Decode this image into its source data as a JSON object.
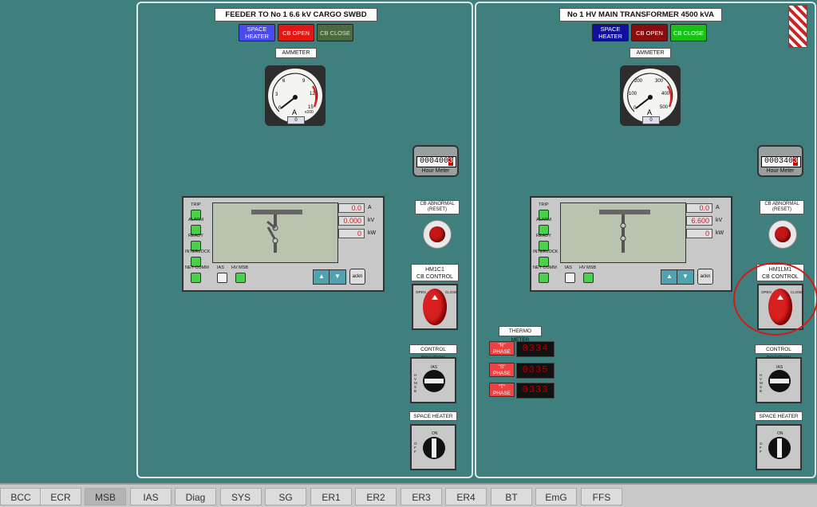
{
  "panel_left": {
    "title": "FEEDER TO No 1 6.6 kV CARGO SWBD",
    "status": {
      "space_heater": "SPACE HEATER",
      "cb_open": "CB OPEN",
      "cb_close": "CB CLOSE"
    },
    "ammeter": {
      "label": "AMMETER",
      "unit": "A",
      "multiplier": "x100",
      "readout": "0",
      "scale": [
        "0",
        "3",
        "6",
        "9",
        "12",
        "15"
      ]
    },
    "hour_meter": {
      "value": "000400",
      "decimal": "3",
      "label": "Hour Meter"
    },
    "relay": {
      "indicators": [
        "TRIP",
        "ALARM",
        "READY",
        "INTERLOCK",
        "NET COMM"
      ],
      "bottom": [
        "IAS",
        "HV MSB"
      ],
      "readings": [
        {
          "value": "0.0",
          "unit": "A"
        },
        {
          "value": "0.000",
          "unit": "kV"
        },
        {
          "value": "0",
          "unit": "kW"
        }
      ],
      "up": "▲",
      "down": "▼",
      "ackn": "ackn"
    },
    "cb_abnormal": "CB ABNORMAL (RESET)",
    "cb_control": {
      "id": "HM1C1",
      "label": "CB CONTROL",
      "open": "OPEN",
      "close": "CLOSE"
    },
    "control_position": {
      "label": "CONTROL POSITION",
      "ias": "IAS",
      "hvmsb": "HVMSB"
    },
    "space_heater": {
      "label": "SPACE HEATER",
      "on": "ON",
      "off": "OFF"
    }
  },
  "panel_right": {
    "title": "No 1 HV MAIN TRANSFORMER 4500 kVA",
    "status": {
      "space_heater": "SPACE HEATER",
      "cb_open": "CB OPEN",
      "cb_close": "CB CLOSE"
    },
    "ammeter": {
      "label": "AMMETER",
      "unit": "A",
      "readout": "0",
      "scale": [
        "0",
        "100",
        "200",
        "300",
        "400",
        "500"
      ]
    },
    "hour_meter": {
      "value": "000340",
      "decimal": "3",
      "label": "Hour Meter"
    },
    "relay": {
      "indicators": [
        "TRIP",
        "ALARM",
        "READY",
        "INTERLOCK",
        "NET COMM"
      ],
      "bottom": [
        "IAS",
        "HV MSB"
      ],
      "readings": [
        {
          "value": "0.0",
          "unit": "A"
        },
        {
          "value": "6.600",
          "unit": "kV"
        },
        {
          "value": "0",
          "unit": "kW"
        }
      ],
      "up": "▲",
      "down": "▼",
      "ackn": "ackn"
    },
    "cb_abnormal": "CB ABNORMAL (RESET)",
    "cb_control": {
      "id": "HM1LM1",
      "label": "CB CONTROL",
      "open": "OPEN",
      "close": "CLOSE"
    },
    "thermo": {
      "label": "THERMO METER",
      "phases": [
        {
          "name": "\"R\" PHASE",
          "value": "0334"
        },
        {
          "name": "\"S\" PHASE",
          "value": "0335"
        },
        {
          "name": "\"T\" PHASE",
          "value": "0333"
        }
      ]
    },
    "control_position": {
      "label": "CONTROL POSITION",
      "ias": "IAS",
      "hvmsb": "HVMSB"
    },
    "space_heater": {
      "label": "SPACE HEATER",
      "on": "ON",
      "off": "OFF"
    }
  },
  "tabs": [
    "BCC",
    "ECR",
    "MSB",
    "IAS",
    "Diag",
    "SYS",
    "SG",
    "ER1",
    "ER2",
    "ER3",
    "ER4",
    "BT",
    "EmG",
    "FFS"
  ],
  "active_tab": "MSB",
  "colors": {
    "background": "#3f7f7d",
    "space_heater_left": "#4a4af0",
    "space_heater_right": "#1010a0",
    "cb_open_left": "#e01818",
    "cb_open_right": "#8a0c0c",
    "cb_close_left": "#4a6a40",
    "cb_close_right": "#18c018",
    "indicator_green": "#4ad04a"
  }
}
